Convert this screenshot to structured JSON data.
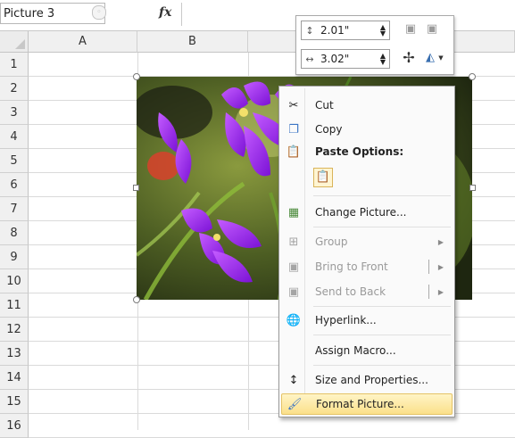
{
  "formula_bar": {
    "name_box": "Picture 3",
    "fx_label": "fx"
  },
  "grid": {
    "columns": [
      "A",
      "B"
    ],
    "rows": [
      "1",
      "2",
      "3",
      "4",
      "5",
      "6",
      "7",
      "8",
      "9",
      "10",
      "11",
      "12",
      "13",
      "14",
      "15",
      "16"
    ]
  },
  "size_toolbar": {
    "height_value": "2.01\"",
    "width_value": "3.02\"",
    "icons": [
      "shape-height-icon",
      "shape-width-icon",
      "bring-forward-icon",
      "send-backward-icon",
      "crop-icon",
      "rotate-icon"
    ]
  },
  "context_menu": {
    "cut": "Cut",
    "copy": "Copy",
    "paste_options": "Paste Options:",
    "change_picture": "Change Picture...",
    "group": "Group",
    "bring_to_front": "Bring to Front",
    "send_to_back": "Send to Back",
    "hyperlink": "Hyperlink...",
    "assign_macro": "Assign Macro...",
    "size_properties": "Size and Properties...",
    "format_picture": "Format Picture..."
  },
  "colors": {
    "highlight": "#fbe08a",
    "orchid": "#9b30e6"
  }
}
